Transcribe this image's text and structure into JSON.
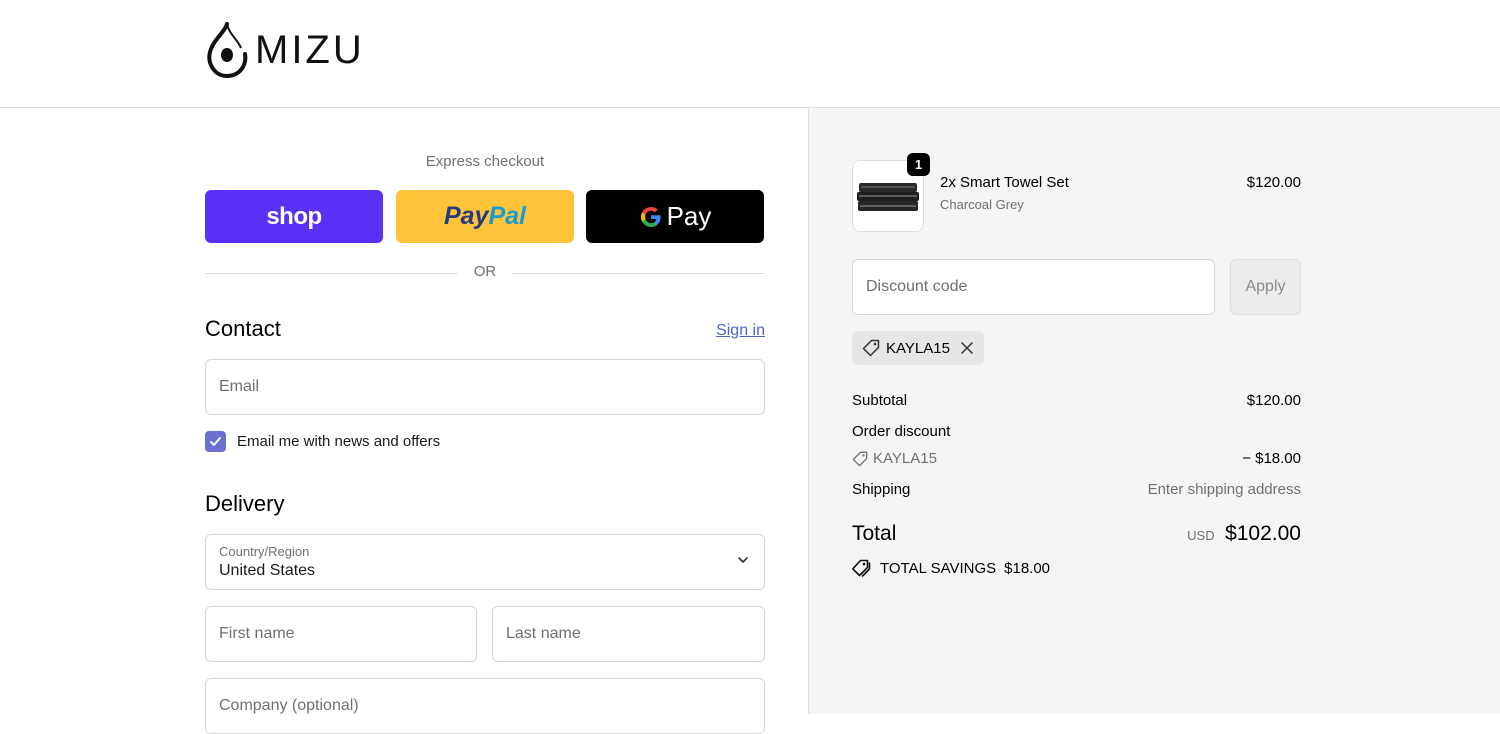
{
  "brand": {
    "name": "MIZU"
  },
  "express": {
    "label": "Express checkout",
    "shop_label": "shop",
    "paypal_part1": "Pay",
    "paypal_part2": "Pal",
    "gpay_label": "Pay",
    "or_label": "OR"
  },
  "contact": {
    "title": "Contact",
    "signin_label": "Sign in",
    "email_placeholder": "Email",
    "newsletter_label": "Email me with news and offers",
    "newsletter_checked": true
  },
  "delivery": {
    "title": "Delivery",
    "country_label": "Country/Region",
    "country_value": "United States",
    "first_name_placeholder": "First name",
    "last_name_placeholder": "Last name",
    "company_placeholder": "Company (optional)"
  },
  "order": {
    "item": {
      "quantity": "1",
      "name": "2x Smart Towel Set",
      "variant": "Charcoal Grey",
      "price": "$120.00"
    },
    "discount_placeholder": "Discount code",
    "apply_label": "Apply",
    "applied_code": "KAYLA15",
    "subtotal_label": "Subtotal",
    "subtotal_value": "$120.00",
    "order_discount_label": "Order discount",
    "discount_code": "KAYLA15",
    "discount_value": "− $18.00",
    "shipping_label": "Shipping",
    "shipping_value": "Enter shipping address",
    "total_label": "Total",
    "total_currency": "USD",
    "total_value": "$102.00",
    "savings_label": "TOTAL SAVINGS",
    "savings_value": "$18.00"
  },
  "colors": {
    "shop": "#5a31f4",
    "paypal": "#ffc439",
    "gpay": "#000000",
    "link": "#4a66c9",
    "checkbox": "#6b6fd1",
    "summary_bg": "#f5f5f5"
  }
}
